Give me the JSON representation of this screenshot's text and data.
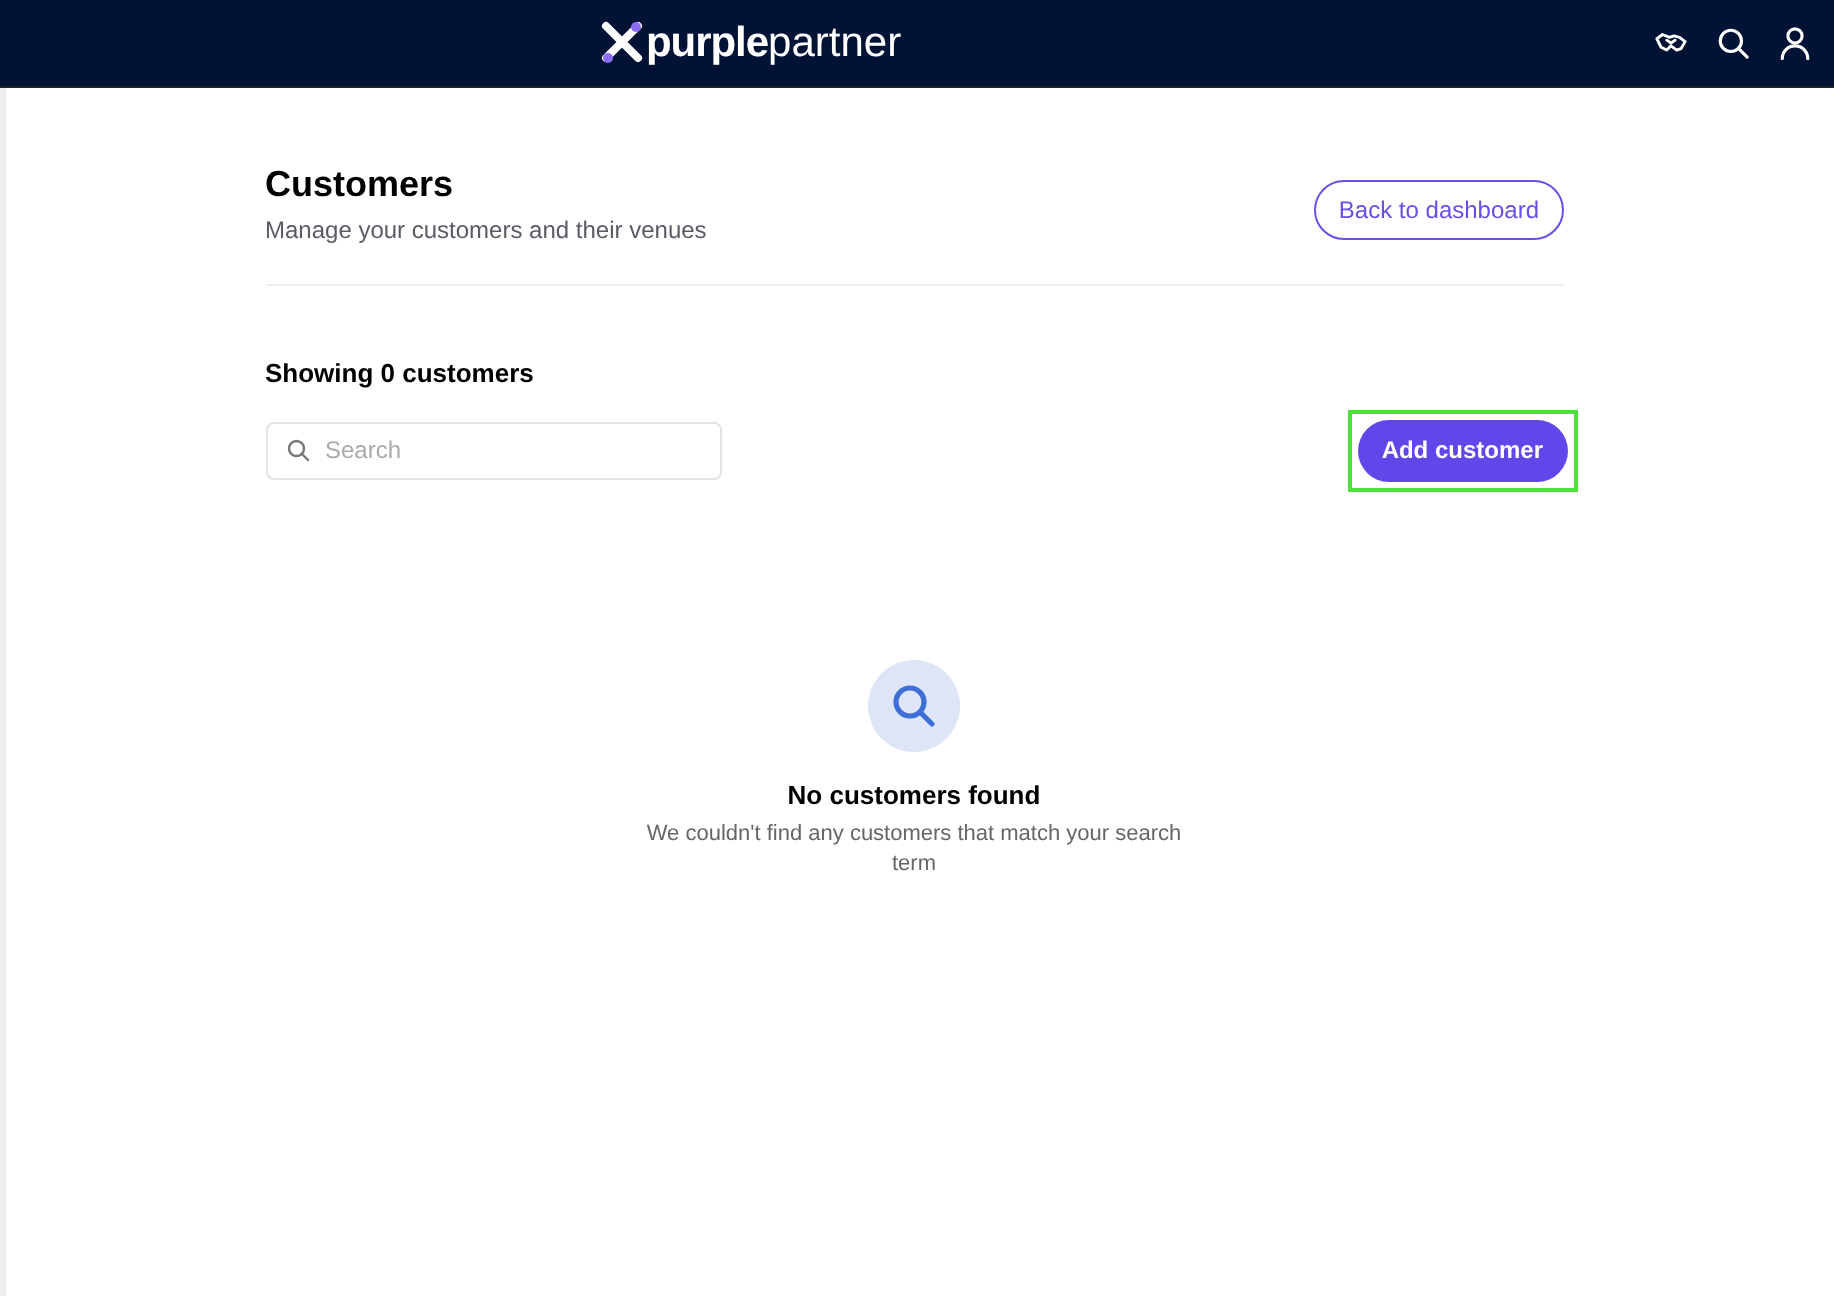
{
  "navbar": {
    "logo": {
      "bold": "purple",
      "light": "partner"
    }
  },
  "header": {
    "title": "Customers",
    "subtitle": "Manage your customers and their venues",
    "back_button": "Back to dashboard"
  },
  "count": "Showing 0 customers",
  "search": {
    "placeholder": "Search"
  },
  "add_button": {
    "label": "Add customer",
    "highlighted": true
  },
  "empty_state": {
    "title": "No customers found",
    "message": "We couldn't find any customers that match your search term"
  }
}
